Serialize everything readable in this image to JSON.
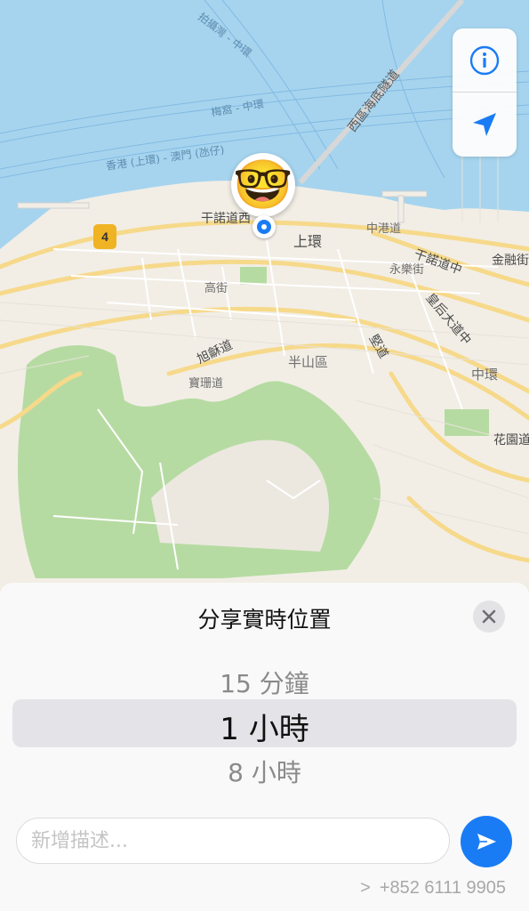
{
  "map": {
    "labels": {
      "water_lane_1": "拍攝灣 - 中環",
      "water_lane_2": "梅窩 - 中環",
      "water_lane_3": "香港 (上環) - 澳門 (氹仔)",
      "tunnel": "西區海底隧道",
      "connaught_west": "干諾道西",
      "sheung_wan": "上環",
      "chung_kong": "中港道",
      "connaught_central": "干諾道中",
      "financial": "金融街",
      "wing_lok": "永樂街",
      "high_street": "高街",
      "queens_road": "皇后大道中",
      "conduit": "堅道",
      "kotewall": "旭龢道",
      "po_shan": "寶珊道",
      "mid_levels": "半山區",
      "central": "中環",
      "garden_road": "花園道"
    },
    "route_badge": "4",
    "avatar_emoji": "🤓",
    "colors": {
      "water": "#a6d4ee",
      "land": "#f2eee6",
      "park": "#b6dba2",
      "road": "#f6d98a",
      "accent": "#1a7cf5"
    }
  },
  "controls": {
    "info_icon": "info-icon",
    "location_icon": "location-arrow-icon"
  },
  "sheet": {
    "title": "分享實時位置",
    "close_icon": "close-icon",
    "picker": {
      "prev": "15 分鐘",
      "selected": "1 小時",
      "next": "8 小時"
    },
    "description_placeholder": "新增描述...",
    "send_icon": "send-icon",
    "phone_chevron": ">",
    "phone": "+852 6111 9905"
  }
}
